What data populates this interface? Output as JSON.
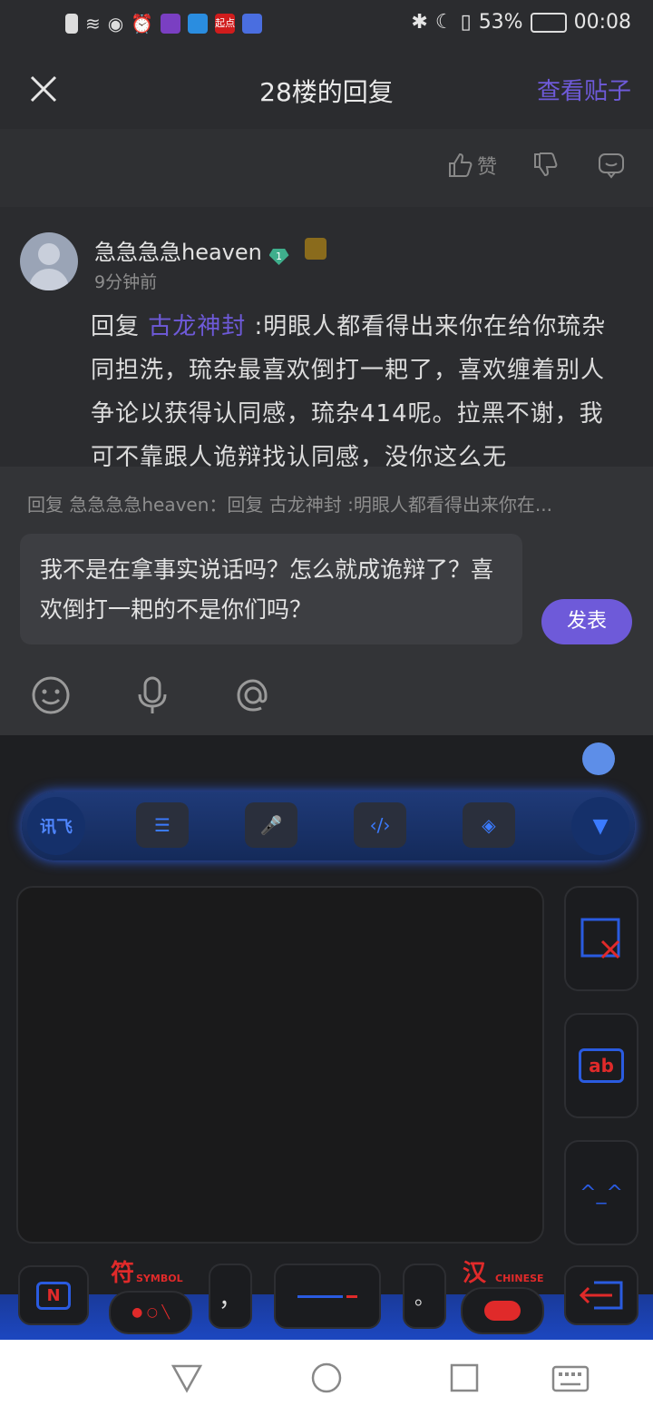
{
  "status_bar": {
    "battery": "53%",
    "time": "00:08",
    "app_icons": [
      "alert-icon",
      "wifi-icon",
      "eye-icon",
      "alarm-icon",
      "app-icon",
      "app-icon",
      "qidian-icon",
      "music-icon"
    ],
    "qidian_label": "起点"
  },
  "header": {
    "title": "28楼的回复",
    "view_post": "查看贴子"
  },
  "actions": {
    "like_label": "赞"
  },
  "post": {
    "username": "急急急急heaven",
    "level_badge": "1",
    "time": "9分钟前",
    "reply_prefix": "回复 ",
    "mention": "古龙神封",
    "content": " :明眼人都看得出来你在给你琉杂同担洗，琉杂最喜欢倒打一耙了，喜欢缠着别人争论以获得认同感，琉杂414呢。拉黑不谢，我可不靠跟人诡辩找认同感，没你这么无"
  },
  "composer": {
    "reply_to": "回复 急急急急heaven：回复 古龙神封  :明眼人都看得出来你在...",
    "input_text": "我不是在拿事实说话吗？怎么就成诡辩了？喜欢倒打一耙的不是你们吗？",
    "submit_label": "发表"
  },
  "keyboard": {
    "toolbar_logo": "讯飞",
    "symbol_label": "符",
    "symbol_sub": "SYMBOL",
    "chinese_label": "汉",
    "chinese_sub": "CHINESE",
    "comma": "，",
    "period": "。",
    "n_key": "N",
    "ab_key": "ab",
    "accent": "#2a5be0",
    "red_accent": "#e02a2a"
  }
}
